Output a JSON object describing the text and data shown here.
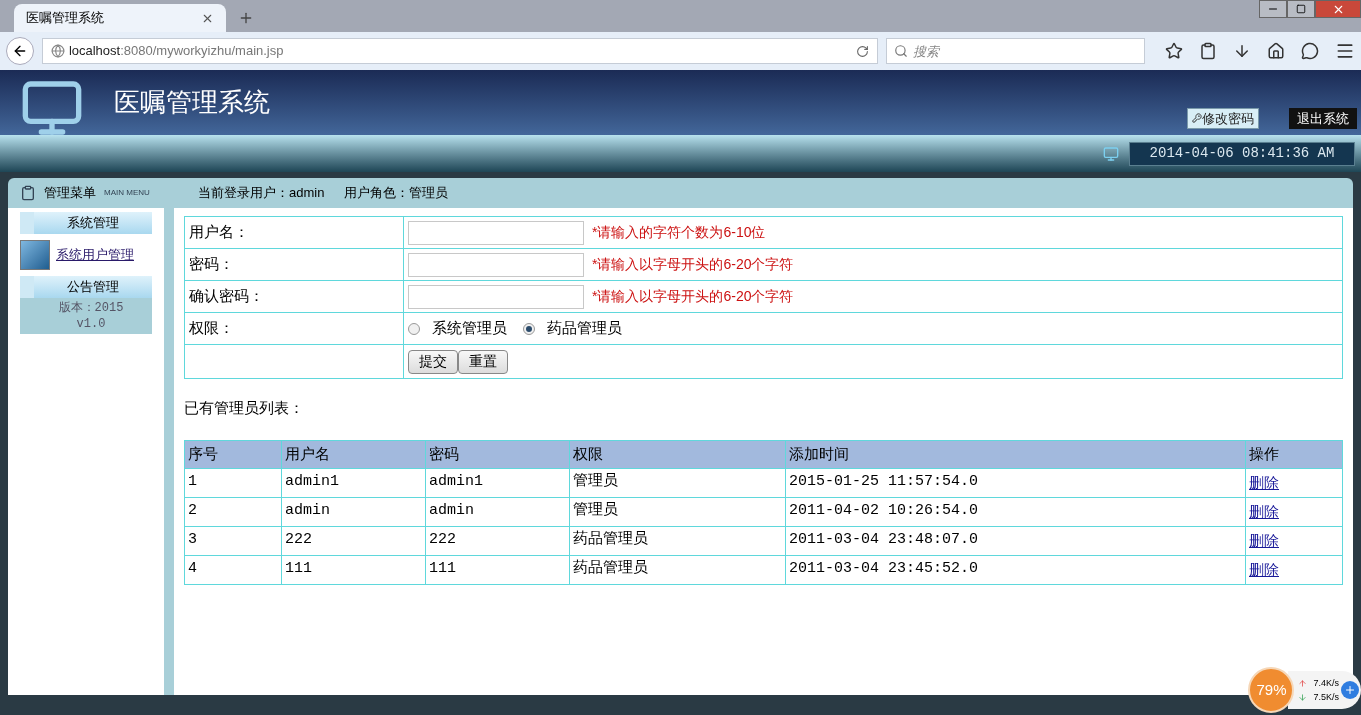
{
  "browser": {
    "tab_title": "医嘱管理系统",
    "url_host": "localhost",
    "url_path": ":8080/myworkyizhu/main.jsp",
    "search": {
      "placeholder": "搜索"
    }
  },
  "header": {
    "title": "医嘱管理系统",
    "buttons": [
      "修改密码",
      "退出系统"
    ],
    "datetime": "2014-04-06 08:41:36 AM"
  },
  "menu_bar": {
    "title": "管理菜单",
    "subtitle": "MAIN MENU",
    "current_user": "当前登录用户：admin",
    "role": "用户角色：管理员"
  },
  "sidebar": {
    "sections": [
      {
        "title": "系统管理",
        "items": [
          {
            "label": "系统用户管理"
          }
        ]
      },
      {
        "title": "公告管理"
      }
    ],
    "version": [
      "版本：2015",
      "v1.0"
    ]
  },
  "form": {
    "rows": [
      {
        "kind": "text",
        "label": "用户名：",
        "hint": "*请输入的字符个数为6-10位"
      },
      {
        "kind": "text",
        "label": "密码：",
        "hint": "*请输入以字母开头的6-20个字符"
      },
      {
        "kind": "text",
        "label": "确认密码：",
        "hint": "*请输入以字母开头的6-20个字符"
      },
      {
        "kind": "radio",
        "label": "权限：",
        "options": [
          {
            "label": "系统管理员",
            "selected": false
          },
          {
            "label": "药品管理员",
            "selected": true
          }
        ]
      }
    ],
    "buttons": [
      "提交",
      "重置"
    ]
  },
  "list_title": "已有管理员列表：",
  "table": {
    "columns": [
      "序号",
      "用户名",
      "密码",
      "权限",
      "添加时间",
      "操作"
    ],
    "rows": [
      {
        "cells": [
          "1",
          "admin1",
          "admin1",
          "管理员",
          "2015-01-25 11:57:54.0"
        ],
        "action": "删除"
      },
      {
        "cells": [
          "2",
          "admin",
          "admin",
          "管理员",
          "2011-04-02 10:26:54.0"
        ],
        "action": "删除"
      },
      {
        "cells": [
          "3",
          "222",
          "222",
          "药品管理员",
          "2011-03-04 23:48:07.0"
        ],
        "action": "删除"
      },
      {
        "cells": [
          "4",
          "111",
          "111",
          "药品管理员",
          "2011-03-04 23:45:52.0"
        ],
        "action": "删除"
      }
    ]
  },
  "net_widget": {
    "percent": "79%",
    "upload": "7.4K/s",
    "download": "7.5K/s"
  }
}
